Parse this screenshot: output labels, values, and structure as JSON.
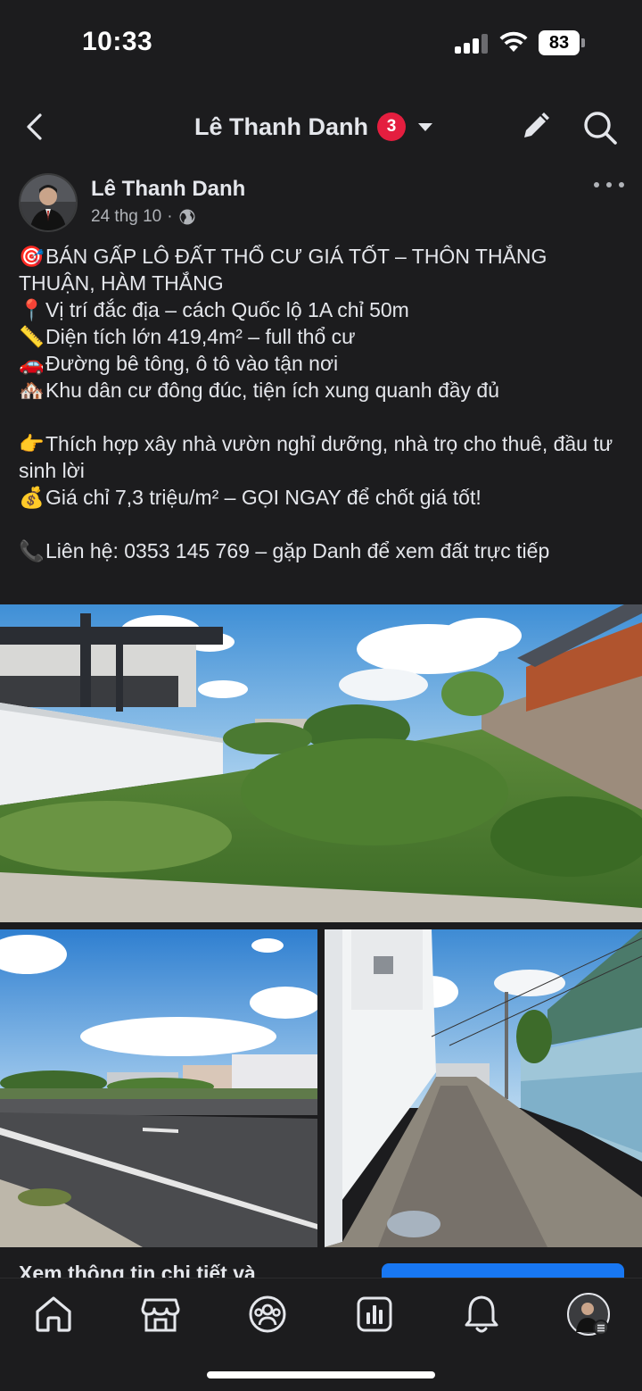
{
  "status_bar": {
    "time": "10:33",
    "battery": "83"
  },
  "header": {
    "title": "Lê Thanh Danh",
    "badge_count": "3",
    "icons": [
      "back-arrow-icon",
      "chevron-down-icon",
      "pencil-icon",
      "search-icon"
    ]
  },
  "post": {
    "author": "Lê Thanh Danh",
    "date": "24 thg 10",
    "privacy_icon": "globe-icon",
    "lines": [
      {
        "emoji": "🎯",
        "text": "BÁN GẤP LÔ ĐẤT THỔ CƯ GIÁ TỐT – THÔN THẮNG THUẬN, HÀM THẮNG"
      },
      {
        "emoji": "📍",
        "text": "Vị trí đắc địa – cách Quốc lộ 1A chỉ 50m"
      },
      {
        "emoji": "📏",
        "text": "Diện tích lớn 419,4m² – full thổ cư"
      },
      {
        "emoji": "🚗",
        "text": "Đường bê tông, ô tô vào tận nơi"
      },
      {
        "emoji": "🏘️",
        "text": "Khu dân cư đông đúc, tiện ích xung quanh đầy đủ"
      },
      {
        "emoji": "👉",
        "text": "Thích hợp xây nhà vườn nghỉ dưỡng, nhà trọ cho thuê, đầu tư sinh lời"
      },
      {
        "emoji": "💰",
        "text": "Giá chỉ 7,3 triệu/m² – GỌI NGAY để chốt giá tốt!"
      },
      {
        "emoji": "📞",
        "text": "Liên hệ: 0353 145 769 – gặp Danh để xem đất trực tiếp"
      }
    ],
    "see_more_peek": "Xem thông tin chi tiết và"
  },
  "tabbar": {
    "items": [
      "home-icon",
      "marketplace-icon",
      "groups-icon",
      "dashboard-icon",
      "bell-icon",
      "profile-avatar"
    ]
  },
  "colors": {
    "background": "#1c1c1e",
    "text": "#e4e6eb",
    "secondary_text": "#b0b3b8",
    "badge": "#e41e3f",
    "accent": "#1877f2"
  }
}
